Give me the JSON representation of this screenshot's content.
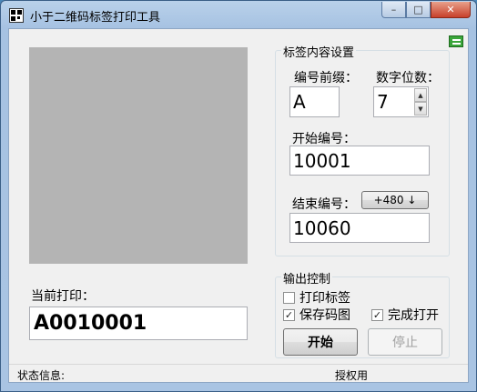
{
  "window": {
    "title": "小于二维码标签打印工具",
    "minimize_glyph": "–",
    "maximize_glyph": "□",
    "close_glyph": "✕"
  },
  "settings": {
    "group_title": "标签内容设置",
    "prefix_label": "编号前缀：",
    "prefix_value": "A",
    "digits_label": "数字位数：",
    "digits_value": "7",
    "spin_up": "▲",
    "spin_down": "▼",
    "start_label": "开始编号：",
    "start_value": "10001",
    "end_label": "结束编号：",
    "end_value": "10060",
    "increment_button": "+480 ↓"
  },
  "current": {
    "label": "当前打印：",
    "value": "A0010001"
  },
  "output": {
    "group_title": "输出控制",
    "print_label_text": "打印标签",
    "print_label_checked": false,
    "save_image_text": "保存码图",
    "save_image_checked": true,
    "open_when_done_text": "完成打开",
    "open_when_done_checked": true,
    "start_button": "开始",
    "stop_button": "停止",
    "check_glyph": "✓"
  },
  "status": {
    "info_label": "状态信息:",
    "license_label": "授权用"
  },
  "colors": {
    "preview_gray": "#b4b4b4",
    "menu_green": "#3aa53a",
    "titlebar_blue": "#b9d1ea"
  },
  "icons": {
    "app": "qr-code-icon",
    "menu": "green-menu-icon"
  }
}
